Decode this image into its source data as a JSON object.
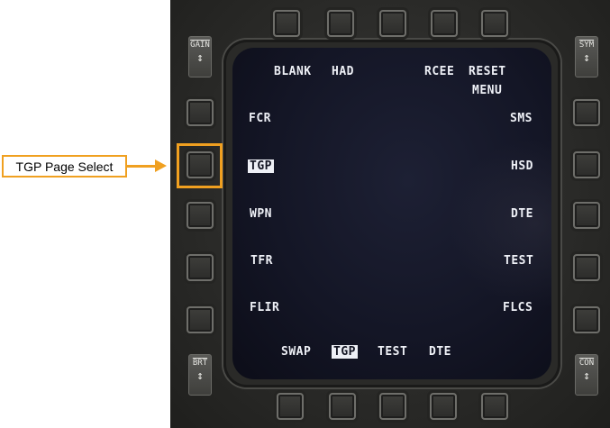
{
  "callout": {
    "text": "TGP Page Select",
    "color": "#f0a020"
  },
  "rockers": {
    "gain": {
      "label": "GAIN"
    },
    "sym": {
      "label": "SYM"
    },
    "brt": {
      "label": "BRT"
    },
    "con": {
      "label": "CON"
    }
  },
  "mfd": {
    "top_labels": [
      "BLANK",
      "HAD",
      "RCEE",
      "RESET"
    ],
    "top_sub_label": "MENU",
    "left_labels": [
      "FCR",
      "TGP",
      "WPN",
      "TFR",
      "FLIR"
    ],
    "right_labels": [
      "SMS",
      "HSD",
      "DTE",
      "TEST",
      "FLCS"
    ],
    "bottom_labels": [
      "SWAP",
      "TGP",
      "TEST",
      "DTE"
    ],
    "selected_left": "TGP",
    "selected_bottom": "TGP"
  }
}
